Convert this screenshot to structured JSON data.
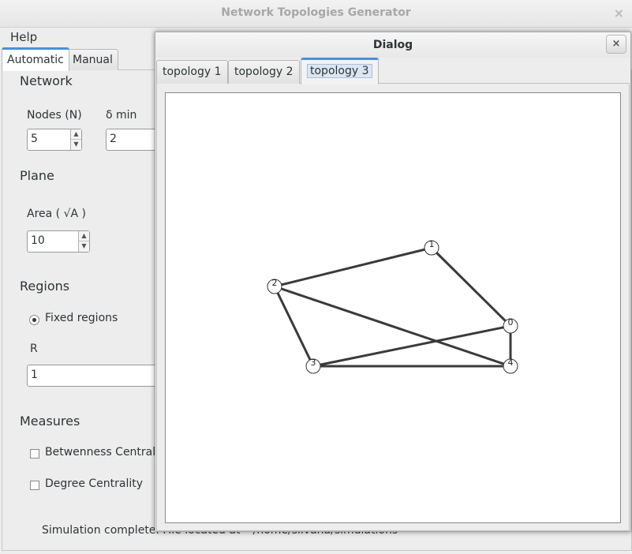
{
  "window": {
    "title": "Network Topologies Generator",
    "close_label": "×"
  },
  "menu": {
    "help": "Help"
  },
  "tabs": {
    "automatic": "Automatic",
    "manual": "Manual"
  },
  "network": {
    "heading": "Network",
    "nodes_label": "Nodes (N)",
    "nodes_value": "5",
    "delta_label": "δ min",
    "delta_value": "2"
  },
  "plane": {
    "heading": "Plane",
    "area_label": "Area ( √A )",
    "area_value": "10"
  },
  "regions": {
    "heading": "Regions",
    "fixed_label": "Fixed regions",
    "r_label": "R",
    "r_value": "1"
  },
  "measures": {
    "heading": "Measures",
    "betweenness_label": "Betwenness Centralit",
    "degree_label": "Degree Centrality"
  },
  "status": {
    "text": "Simulation complete. File located at ~/home/silvana/simulations"
  },
  "dialog": {
    "title": "Dialog",
    "close_label": "×",
    "tabs": [
      "topology 1",
      "topology 2",
      "topology 3"
    ],
    "active_tab": 2
  },
  "graph": {
    "nodes": [
      {
        "id": "0"
      },
      {
        "id": "1"
      },
      {
        "id": "2"
      },
      {
        "id": "3"
      },
      {
        "id": "4"
      }
    ],
    "edges": [
      [
        "2",
        "1"
      ],
      [
        "1",
        "0"
      ],
      [
        "0",
        "4"
      ],
      [
        "2",
        "4"
      ],
      [
        "2",
        "3"
      ],
      [
        "3",
        "0"
      ],
      [
        "3",
        "4"
      ]
    ],
    "edge_color": "#3a3a3a"
  },
  "colors": {
    "accent": "#4a90d9"
  }
}
